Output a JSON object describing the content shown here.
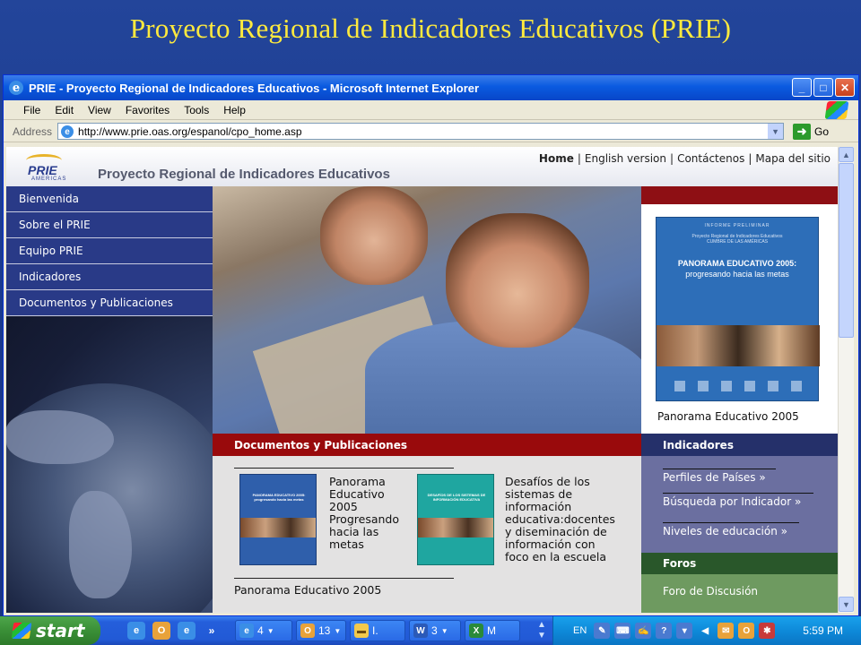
{
  "slide": {
    "title": "Proyecto Regional de Indicadores Educativos (PRIE)"
  },
  "browser": {
    "window_title": "PRIE - Proyecto Regional de Indicadores Educativos - Microsoft Internet Explorer",
    "menu": [
      "File",
      "Edit",
      "View",
      "Favorites",
      "Tools",
      "Help"
    ],
    "address_label": "Address",
    "address_url": "http://www.prie.oas.org/espanol/cpo_home.asp",
    "go_label": "Go"
  },
  "page": {
    "logo_text": "PRIE",
    "logo_sub": "AMERICAS",
    "site_title": "Proyecto Regional de Indicadores Educativos",
    "topnav": [
      "Home",
      "English version",
      "Contáctenos",
      "Mapa del sitio"
    ],
    "leftnav": [
      "Bienvenida",
      "Sobre el PRIE",
      "Equipo PRIE",
      "Indicadores",
      "Documentos y Publicaciones"
    ],
    "cover": {
      "top": "INFORME PRELIMINAR",
      "org": "Proyecto Regional de Indicadores Educativos",
      "org2": "CUMBRE DE LAS AMÉRICAS",
      "title": "PANORAMA EDUCATIVO 2005:",
      "subtitle": "progresando hacia las metas"
    },
    "cover_caption": "Panorama Educativo 2005",
    "docs": {
      "heading": "Documentos y Publicaciones",
      "pub1_cover": "PANORAMA EDUCATIVO 2005: progresando hacia las metas",
      "pub1": [
        "Panorama",
        "Educativo",
        "2005",
        "Progresando",
        "hacia las",
        "metas"
      ],
      "pub2_cover": "DESAFÍOS DE LOS SISTEMAS DE INFORMACIÓN EDUCATIVA",
      "pub2": [
        "Desafíos de los",
        "sistemas de",
        "información",
        "educativa:docentes",
        "y diseminación de",
        "información con",
        "foco en la escuela"
      ],
      "bottom": "Panorama Educativo 2005"
    },
    "indicadores": {
      "heading": "Indicadores",
      "items": [
        "Perfiles de Países »",
        "Búsqueda por Indicador »",
        "Niveles de educación »"
      ]
    },
    "foros": {
      "heading": "Foros",
      "items": [
        "Foro de Discusión"
      ]
    }
  },
  "taskbar": {
    "start": "start",
    "items": [
      {
        "label": "4",
        "icon": "ie-icon"
      },
      {
        "label": "13",
        "icon": "outlook-icon"
      },
      {
        "label": "I.",
        "icon": "folder-icon"
      },
      {
        "label": "3",
        "icon": "word-icon"
      },
      {
        "label": "M",
        "icon": "excel-icon"
      }
    ],
    "lang": "EN",
    "clock": "5:59 PM"
  },
  "colors": {
    "slide_title": "#ffea3d",
    "nav_blue": "#293a87",
    "doc_red": "#990a0c",
    "ind_purple": "#6b6fa0",
    "foros_green": "#6e9a60"
  }
}
